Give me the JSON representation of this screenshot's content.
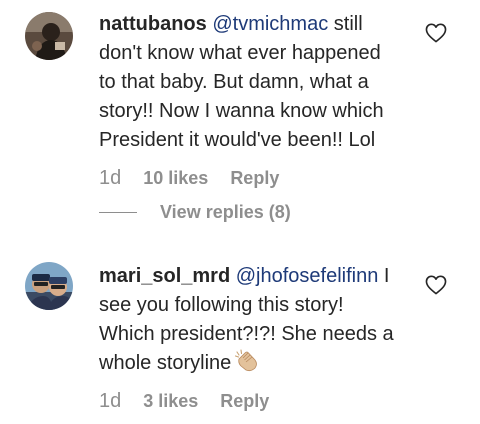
{
  "comments": [
    {
      "username": "nattubanos",
      "mention": "@tvmichmac",
      "lines": [
        " still",
        "don't know what ever happened",
        "to that baby. But damn, what a",
        "story!! Now I wanna know which",
        "President it would've been!! Lol"
      ],
      "time": "1d",
      "likes": "10 likes",
      "reply_label": "Reply",
      "view_replies": "View replies (8)",
      "avatar_icon": "profile-avatar",
      "like_icon": "heart-outline-icon"
    },
    {
      "username": "mari_sol_mrd",
      "mention": "@jhofosefelifinn",
      "lines": [
        " I",
        "see you following this story!",
        "Which president?!?! She needs a",
        "whole storyline"
      ],
      "emoji": "clapping-hands",
      "time": "1d",
      "likes": "3 likes",
      "reply_label": "Reply",
      "avatar_icon": "profile-avatar",
      "like_icon": "heart-outline-icon"
    }
  ],
  "colors": {
    "text": "#262626",
    "mention": "#1e3a78",
    "secondary": "#8e8e8e",
    "background": "#ffffff"
  }
}
